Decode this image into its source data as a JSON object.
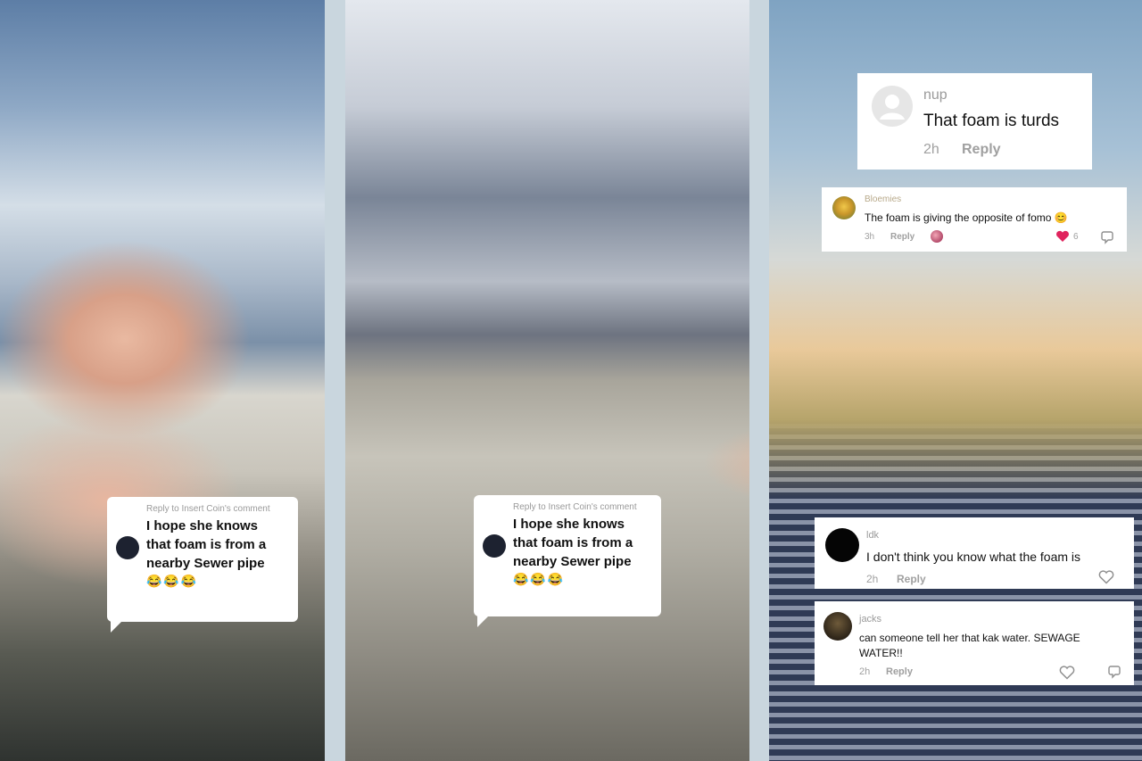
{
  "panels": [
    {
      "bubble": {
        "reply_to": "Reply to Insert Coin's comment",
        "text_lines": [
          "I hope she knows",
          "that foam is from a",
          "nearby Sewer pipe"
        ],
        "emojis": "😂😂😂"
      }
    },
    {
      "bubble": {
        "reply_to": "Reply to Insert Coin's comment",
        "text_lines": [
          "I hope she knows",
          "that foam is from a",
          "nearby Sewer pipe"
        ],
        "emojis": "😂😂😂"
      }
    },
    {
      "comments": [
        {
          "user": "nup",
          "text": "That foam is turds",
          "time": "2h",
          "reply": "Reply"
        },
        {
          "user": "Bloemies",
          "text": "The foam is giving the opposite of fomo 😊",
          "time": "3h",
          "reply": "Reply",
          "likes": "6"
        },
        {
          "user": "ldk",
          "text": "I don't think you know what the foam is",
          "time": "2h",
          "reply": "Reply"
        },
        {
          "user": "jacks",
          "text_lines": [
            "can someone tell her that kak water. SEWAGE",
            "WATER!!"
          ],
          "time": "2h",
          "reply": "Reply"
        }
      ]
    }
  ],
  "colors": {
    "like_red": "#e0245e",
    "meta_gray": "#a0a0a0",
    "divider": "#c9d6de"
  },
  "icons": [
    "heart-icon",
    "dislike-icon",
    "reaction-avatar-icon",
    "default-avatar-icon"
  ]
}
